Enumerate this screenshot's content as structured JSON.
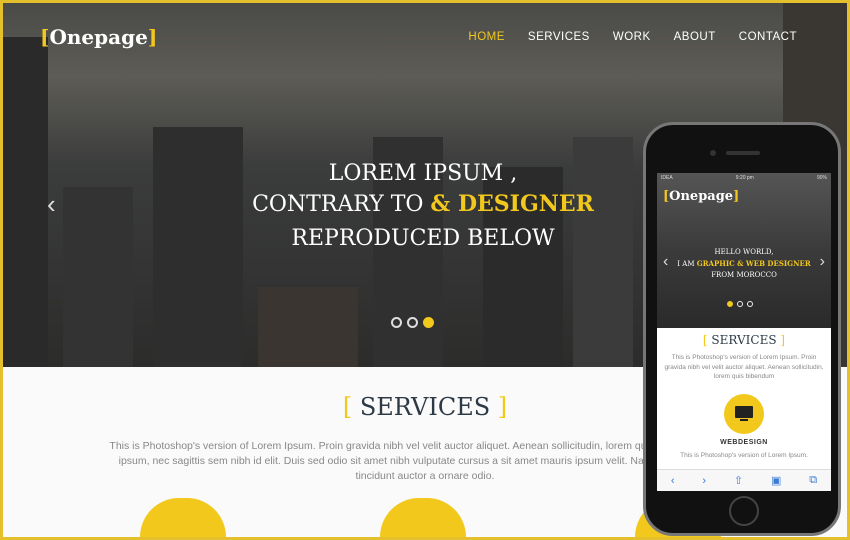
{
  "header": {
    "logo": "Onepage",
    "nav": [
      {
        "label": "HOME",
        "active": true
      },
      {
        "label": "SERVICES"
      },
      {
        "label": "WORK"
      },
      {
        "label": "ABOUT"
      },
      {
        "label": "CONTACT"
      }
    ]
  },
  "hero": {
    "line1": "LOREM IPSUM ,",
    "line2_prefix": "CONTRARY TO",
    "line2_highlight": "& DESIGNER",
    "line3": "REPRODUCED BELOW",
    "active_slide": 3,
    "slides": 3
  },
  "services": {
    "title": "SERVICES",
    "text": "This is Photoshop's version of Lorem Ipsum. Proin gravida nibh vel velit auctor aliquet. Aenean sollicitudin, lorem quis nisi elit consequat ipsum, nec sagittis sem nibh id elit. Duis sed odio sit amet nibh vulputate cursus a sit amet mauris ipsum velit. Nam nec tellus a odio tincidunt auctor a ornare odio."
  },
  "phone": {
    "carrier": "IDEA",
    "time": "9:20 pm",
    "battery": "90%",
    "logo": "Onepage",
    "hero_line1": "HELLO WORLD,",
    "hero_line2_prefix": "I AM",
    "hero_line2_highlight": "GRAPHIC & WEB DESIGNER",
    "hero_line3": "FROM MOROCCO",
    "services_title": "SERVICES",
    "services_text": "This is Photoshop's version of Lorem Ipsum. Proin gravida nibh vel velit auctor aliquet. Aenean sollicitudin, lorem quis bibendum",
    "service_name": "WEBDESIGN",
    "service_text": "This is Photoshop's version of Lorem Ipsum."
  },
  "colors": {
    "accent": "#f2c81d",
    "dark_text": "#2d3a46",
    "frame": "#e3c02c"
  }
}
